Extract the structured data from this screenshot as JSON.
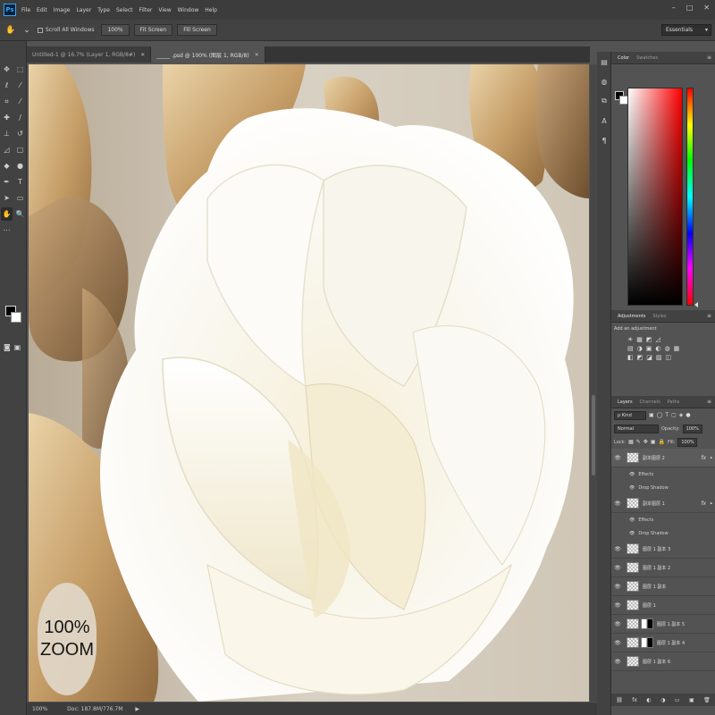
{
  "menu": {
    "logo": "Ps",
    "items": [
      "File",
      "Edit",
      "Image",
      "Layer",
      "Type",
      "Select",
      "Filter",
      "View",
      "Window",
      "Help"
    ],
    "window_controls": [
      "–",
      "□",
      "✕"
    ]
  },
  "options": {
    "scroll_all_windows": "Scroll All Windows",
    "zoom_value": "100%",
    "fit_screen": "Fit Screen",
    "fill_screen": "Fill Screen",
    "workspace": "Essentials"
  },
  "tabs": [
    {
      "label": "Untitled-1 @ 16.7% (Layer 1, RGB/8#)",
      "close": "✕"
    },
    {
      "label": "_____ .psd @ 100% (图层 1, RGB/8)",
      "close": "✕"
    }
  ],
  "canvas": {
    "zoom_badge_line1": "100%",
    "zoom_badge_line2": "ZOOM"
  },
  "status": {
    "zoom": "100%",
    "doc": "Doc: 187.8M/776.7M",
    "arrow": "▶"
  },
  "colors": {
    "accent_blue": "#31a8ff",
    "panel_bg": "#535353",
    "panel_header": "#424242"
  },
  "color_panel": {
    "tabs": [
      "Color",
      "Swatches"
    ],
    "menu": "≡"
  },
  "adjustments": {
    "tabs": [
      "Adjustments",
      "Styles"
    ],
    "menu": "≡",
    "title": "Add an adjustment",
    "row1": [
      "☀",
      "▦",
      "◩",
      "◿"
    ],
    "row2": [
      "▤",
      "◑",
      "▣",
      "◐",
      "◍",
      "▦"
    ],
    "row3": [
      "◧",
      "◩",
      "◪",
      "▨",
      "◫"
    ]
  },
  "layers_panel": {
    "tabs": [
      "Layers",
      "Channels",
      "Paths"
    ],
    "menu": "≡",
    "filter_kind": "ρ Kind",
    "filter_icons": [
      "▣",
      "◯",
      "T",
      "▢",
      "◈",
      "●"
    ],
    "blend_mode": "Normal",
    "opacity_label": "Opacity:",
    "opacity_value": "100%",
    "lock_label": "Lock:",
    "lock_icons": [
      "▦",
      "✎",
      "✥",
      "▣",
      "🔒"
    ],
    "fill_label": "Fill:",
    "fill_value": "100%",
    "rows": [
      {
        "type": "layer",
        "name": "副本图层 2",
        "fx": "fx",
        "selected": true
      },
      {
        "type": "sub",
        "name": "Effects"
      },
      {
        "type": "sub",
        "name": "Drop Shadow"
      },
      {
        "type": "layer",
        "name": "副本图层 1",
        "fx": "fx"
      },
      {
        "type": "sub",
        "name": "Effects"
      },
      {
        "type": "sub",
        "name": "Drop Shadow"
      },
      {
        "type": "layer",
        "name": "图层 1 副本 3"
      },
      {
        "type": "layer",
        "name": "图层 1 副本 2"
      },
      {
        "type": "layer",
        "name": "图层 1 副本"
      },
      {
        "type": "layer",
        "name": "图层 1"
      },
      {
        "type": "layer",
        "name": "图层 1 副本 5",
        "mask": true
      },
      {
        "type": "layer",
        "name": "图层 1 副本 4",
        "mask": true
      },
      {
        "type": "layer",
        "name": "图层 1 副本 6"
      }
    ],
    "footer_icons": [
      "⛓",
      "fx",
      "◐",
      "◑",
      "▭",
      "▣",
      "🗑"
    ]
  }
}
